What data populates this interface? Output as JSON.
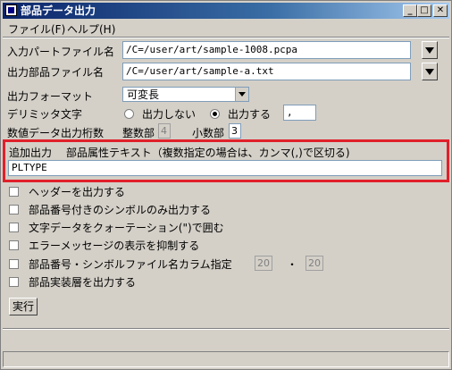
{
  "window": {
    "title": "部品データ出力",
    "min": "_",
    "max": "□",
    "close": "✕"
  },
  "menu": {
    "file": "ファイル(F)",
    "help": "ヘルプ(H)"
  },
  "input_file": {
    "label": "入力パートファイル名",
    "value": "/C=/user/art/sample-1008.pcpa"
  },
  "output_file": {
    "label": "出力部品ファイル名",
    "value": "/C=/user/art/sample-a.txt"
  },
  "format": {
    "label": "出力フォーマット",
    "value": "可変長"
  },
  "delimiter": {
    "label": "デリミッタ文字",
    "opt_no": "出力しない",
    "opt_yes": "出力する",
    "selected": "出力する",
    "value": ","
  },
  "digits": {
    "label": "数値データ出力桁数",
    "int_label": "整数部",
    "int_value": "4",
    "dec_label": "小数部",
    "dec_value": "3"
  },
  "extra": {
    "label": "追加出力",
    "desc": "部品属性テキスト（複数指定の場合は、カンマ(,)で区切る)",
    "value": "PLTYPE"
  },
  "options": [
    {
      "label": "ヘッダーを出力する",
      "checked": false
    },
    {
      "label": "部品番号付きのシンボルのみ出力する",
      "checked": false
    },
    {
      "label": "文字データをクォーテーション(\")で囲む",
      "checked": false
    },
    {
      "label": "エラーメッセージの表示を抑制する",
      "checked": false
    },
    {
      "label": "部品番号・シンボルファイル名カラム指定",
      "checked": false
    },
    {
      "label": "部品実装層を出力する",
      "checked": false
    }
  ],
  "column": {
    "a": "20",
    "dot": "・",
    "b": "20"
  },
  "execute": "実行",
  "colors": {
    "title_start": "#0a246a",
    "title_end": "#a6caf0",
    "highlight": "#e0202a"
  }
}
